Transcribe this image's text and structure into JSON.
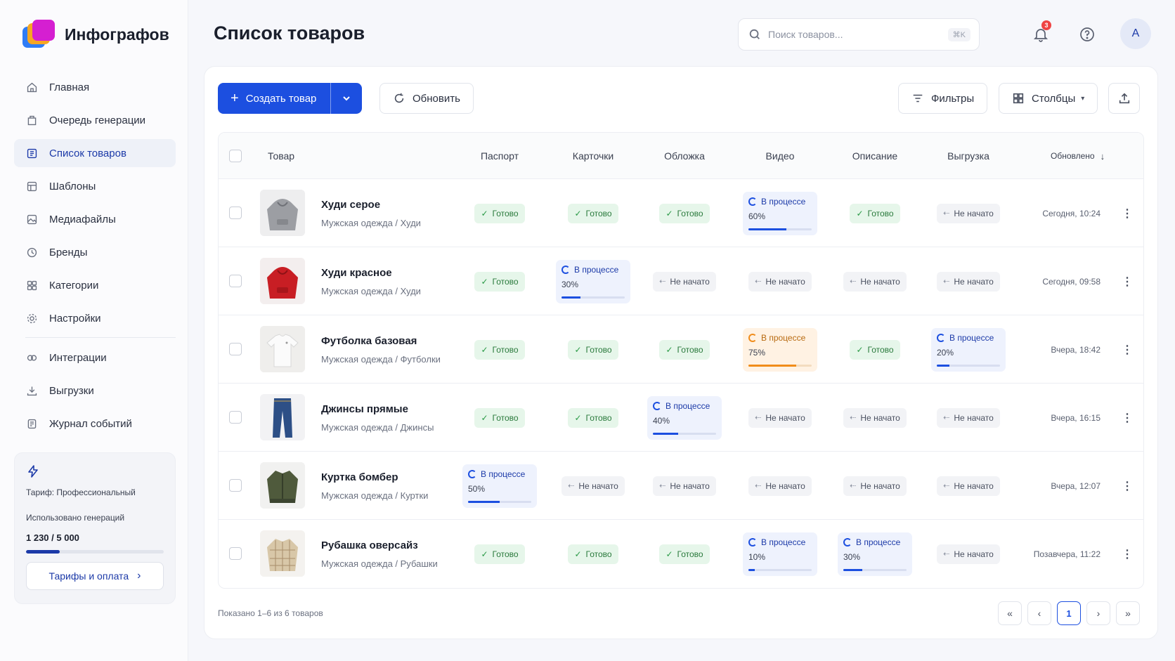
{
  "app": {
    "name": "Инфографов"
  },
  "sidebar": {
    "items": [
      {
        "label": "Главная",
        "icon": "home-icon"
      },
      {
        "label": "Очередь генерации",
        "icon": "queue-icon"
      },
      {
        "label": "Список товаров",
        "icon": "list-icon",
        "active": true
      },
      {
        "label": "Шаблоны",
        "icon": "template-icon"
      },
      {
        "label": "Медиафайлы",
        "icon": "image-icon"
      },
      {
        "label": "Бренды",
        "icon": "brand-icon"
      },
      {
        "label": "Категории",
        "icon": "category-icon"
      },
      {
        "label": "Настройки",
        "icon": "gear-icon"
      },
      {
        "label": "Интеграции",
        "icon": "integration-icon"
      },
      {
        "label": "Выгрузки",
        "icon": "download-icon"
      },
      {
        "label": "Журнал событий",
        "icon": "log-icon"
      }
    ]
  },
  "plan": {
    "name": "Тариф: Профессиональный",
    "used_label": "Использовано генераций",
    "used_value": "1 230 / 5 000",
    "used_fraction": 0.246,
    "button_label": "Тарифы и оплата"
  },
  "header": {
    "title": "Список товаров",
    "search_placeholder": "Поиск товаров...",
    "search_shortcut": "⌘K",
    "notifications_count": "3",
    "avatar_letter": "A"
  },
  "toolbar": {
    "create_label": "Создать товар",
    "refresh_label": "Обновить",
    "filters_label": "Фильтры",
    "columns_label": "Столбцы"
  },
  "table": {
    "columns": {
      "product": "Товар",
      "passport": "Паспорт",
      "cards": "Карточки",
      "cover": "Обложка",
      "video": "Видео",
      "description": "Описание",
      "export": "Выгрузка",
      "updated": "Обновлено"
    },
    "status_labels": {
      "done": "Готово",
      "progress": "В процессе",
      "none": "Не начато"
    },
    "rows": [
      {
        "name": "Худи серое",
        "category": "Мужская одежда / Худи",
        "thumb": "hoodie-gray",
        "statuses": [
          {
            "s": "done"
          },
          {
            "s": "done"
          },
          {
            "s": "done"
          },
          {
            "s": "progress",
            "pct": "60%",
            "value": 0.6
          },
          {
            "s": "done"
          },
          {
            "s": "none"
          }
        ],
        "updated": "Сегодня, 10:24"
      },
      {
        "name": "Худи красное",
        "category": "Мужская одежда / Худи",
        "thumb": "hoodie-red",
        "statuses": [
          {
            "s": "done"
          },
          {
            "s": "progress",
            "pct": "30%",
            "value": 0.3
          },
          {
            "s": "none"
          },
          {
            "s": "none"
          },
          {
            "s": "none"
          },
          {
            "s": "none"
          }
        ],
        "updated": "Сегодня, 09:58"
      },
      {
        "name": "Футболка базовая",
        "category": "Мужская одежда / Футболки",
        "thumb": "tshirt-white",
        "statuses": [
          {
            "s": "done"
          },
          {
            "s": "done"
          },
          {
            "s": "done"
          },
          {
            "s": "progress",
            "pct": "75%",
            "value": 0.75,
            "color": "orange"
          },
          {
            "s": "done"
          },
          {
            "s": "progress",
            "pct": "20%",
            "value": 0.2
          }
        ],
        "updated": "Вчера, 18:42"
      },
      {
        "name": "Джинсы прямые",
        "category": "Мужская одежда / Джинсы",
        "thumb": "jeans",
        "statuses": [
          {
            "s": "done"
          },
          {
            "s": "done"
          },
          {
            "s": "progress",
            "pct": "40%",
            "value": 0.4
          },
          {
            "s": "none"
          },
          {
            "s": "none"
          },
          {
            "s": "none"
          }
        ],
        "updated": "Вчера, 16:15"
      },
      {
        "name": "Куртка бомбер",
        "category": "Мужская одежда / Куртки",
        "thumb": "bomber-jacket",
        "statuses": [
          {
            "s": "progress",
            "pct": "50%",
            "value": 0.5
          },
          {
            "s": "none"
          },
          {
            "s": "none"
          },
          {
            "s": "none"
          },
          {
            "s": "none"
          },
          {
            "s": "none"
          }
        ],
        "updated": "Вчера, 12:07"
      },
      {
        "name": "Рубашка оверсайз",
        "category": "Мужская одежда / Рубашки",
        "thumb": "shirt-plaid",
        "statuses": [
          {
            "s": "done"
          },
          {
            "s": "done"
          },
          {
            "s": "done"
          },
          {
            "s": "progress",
            "pct": "10%",
            "value": 0.1
          },
          {
            "s": "progress",
            "pct": "30%",
            "value": 0.3
          },
          {
            "s": "none"
          }
        ],
        "updated": "Позавчера, 11:22"
      }
    ]
  },
  "footer": {
    "summary": "Показано 1–6 из 6 товаров",
    "current_page": "1"
  },
  "colors": {
    "accent": "#1c4fe0",
    "done": "#2a9a46",
    "progress_orange": "#f08c1a"
  }
}
